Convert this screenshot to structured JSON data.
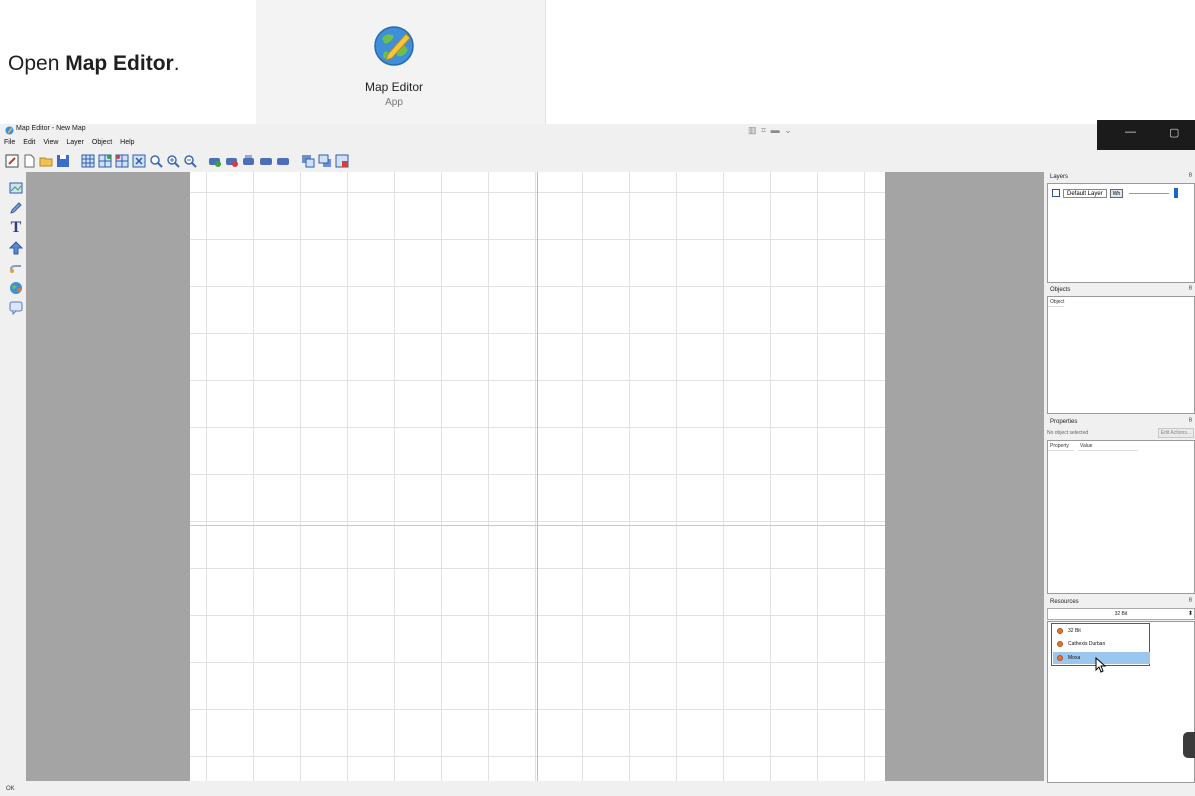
{
  "instruction": {
    "prefix": "Open ",
    "app_name": "Map Editor",
    "suffix": "."
  },
  "start_tile": {
    "name": "Map Editor",
    "kind": "App",
    "icon": "map-editor-globe-icon"
  },
  "window": {
    "title": "Map Editor - New Map",
    "snap_glyphs": "▥ ⌗ ▬ ⌄",
    "minimize_glyph": "—",
    "maximize_glyph": "▢"
  },
  "menu": [
    "File",
    "Edit",
    "View",
    "Layer",
    "Object",
    "Help"
  ],
  "toolbar_icons": [
    "edit-icon",
    "new-file-icon",
    "open-folder-icon",
    "save-icon",
    "grid-icon",
    "add-rows-icon",
    "add-columns-icon",
    "remove-grid-icon",
    "zoom-fit-icon",
    "zoom-in-icon",
    "zoom-out-icon",
    "camera-add-icon",
    "camera-remove-icon",
    "camera-group-icon",
    "camera-left-icon",
    "camera-right-icon",
    "window-back-icon",
    "window-front-icon",
    "window-close-icon"
  ],
  "left_tools": [
    "map-icon",
    "pencil-icon",
    "text-tool-icon",
    "arrow-up-icon",
    "link-icon",
    "globe-icon",
    "comment-icon"
  ],
  "text_tool_glyph": "T",
  "layers_panel": {
    "title": "Layers",
    "layer_name": "Default Layer",
    "layer_button": "Wh",
    "float_glyph": "ᴮ"
  },
  "objects_panel": {
    "title": "Objects",
    "column_header": "Object",
    "float_glyph": "ᴮ"
  },
  "properties_panel": {
    "title": "Properties",
    "selection_text": "No object selected",
    "edit_actions_label": "Edit Actions...",
    "columns": [
      "Property",
      "Value"
    ],
    "float_glyph": "ᴮ"
  },
  "resources_panel": {
    "title": "Resources",
    "selected": "32 Bit",
    "options": [
      "32 Bit",
      "Cathexis Durban",
      "Moxa"
    ],
    "highlighted_index": 2,
    "float_glyph": "ᴮ",
    "select_arrow": "⬍"
  },
  "status": {
    "text": "OK"
  },
  "colors": {
    "canvas_bg": "#a4a4a4",
    "map_bg": "#ffffff",
    "grid_line": "#e2e2e2",
    "selection": "#9bc7ef",
    "title_controls_bg": "#1b1b1b"
  }
}
